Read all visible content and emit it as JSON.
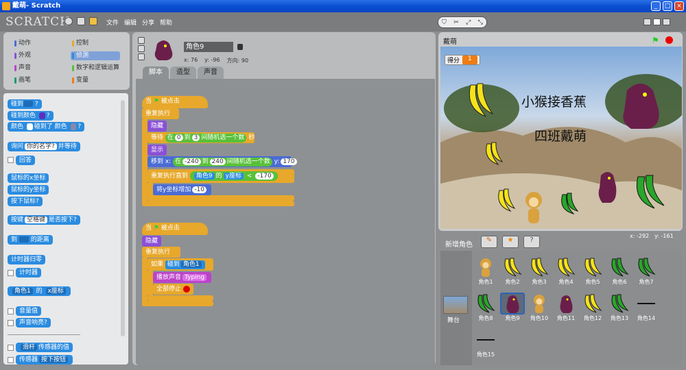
{
  "window": {
    "title": "戴萌- Scratch",
    "min": "_",
    "max": "□",
    "close": "×"
  },
  "app": {
    "logo": "SCRATCH",
    "menus": [
      "文件",
      "编辑",
      "分享",
      "帮助"
    ]
  },
  "categories": [
    {
      "label": "动作",
      "color": "#4a6cd4"
    },
    {
      "label": "控制",
      "color": "#e7a82b"
    },
    {
      "label": "外观",
      "color": "#8b50d6"
    },
    {
      "label": "侦测",
      "color": "#2b8ce0"
    },
    {
      "label": "声音",
      "color": "#bb43c9"
    },
    {
      "label": "数字和逻辑运算",
      "color": "#59c03a"
    },
    {
      "label": "画笔",
      "color": "#0e9a6c"
    },
    {
      "label": "变量",
      "color": "#ee7d16"
    }
  ],
  "palette": {
    "touching": "碰到",
    "touching_color": "碰到颜色",
    "color": "颜色",
    "touch_color2": "碰到了 颜色",
    "q": "?",
    "ask": "询问",
    "ask_default": "你的名字?",
    "and_wait": "并等待",
    "answer": "回答",
    "mouse_x": "鼠标的x坐标",
    "mouse_y": "鼠标的y坐标",
    "mouse_down": "按下鼠标?",
    "key": "按键",
    "key_val": "空格键",
    "key_pressed": "是否按下?",
    "to": "到",
    "distance": "的距离",
    "timer_reset": "计时器归零",
    "timer": "计时器",
    "sprite1": "角色1",
    "of": "的",
    "xpos": "x座标",
    "loudness": "音量值",
    "loud": "声音响亮?",
    "slider": "滑杆",
    "sensor_val": "传感器的值",
    "sensor": "传感器",
    "btn_pressed": "按下按钮"
  },
  "sprite_info": {
    "name": "角色9",
    "x": "x: 76",
    "y": "y: -96",
    "dir": "方向: 90"
  },
  "tabs": [
    "脚本",
    "造型",
    "声音"
  ],
  "script1": {
    "when": "当",
    "clicked": "被点击",
    "forever": "重复执行",
    "hide": "隐藏",
    "wait": "等待",
    "in": "在",
    "to": "到",
    "rand": "间随机选一个数",
    "sec": "秒",
    "w1": "0",
    "w2": "3",
    "show": "显示",
    "goto": "移到 x:",
    "x1": "-240",
    "x2": "240",
    "y": "y:",
    "yv": "170",
    "repeat_until": "重复执行直到",
    "spr": "角色9",
    "of": "的",
    "ypos": "y座标",
    "lt": "<",
    "lv": "-170",
    "change": "将y坐标增加",
    "cv": "-10"
  },
  "script2": {
    "when": "当",
    "clicked": "被点击",
    "hide": "隐藏",
    "forever": "重复执行",
    "if": "如果",
    "touch": "碰到",
    "spr": "角色1",
    "play": "播放声音",
    "sound": "Typing",
    "stop": "全部停止"
  },
  "stage": {
    "title": "戴萌",
    "score_label": "得分",
    "score": "1",
    "text1": "小猴接香蕉",
    "text2": "四班戴萌",
    "mx": "x: -292",
    "my": "y: -161"
  },
  "sprites_header": "新增角色",
  "stage_label": "舞台",
  "sprites": [
    "角色1",
    "角色2",
    "角色3",
    "角色4",
    "角色5",
    "角色6",
    "角色7",
    "角色8",
    "角色9",
    "角色10",
    "角色11",
    "角色12",
    "角色13",
    "角色14",
    "角色15"
  ],
  "sprite_kinds": [
    "monkey",
    "yb",
    "yb",
    "yb",
    "yb",
    "gb",
    "gb",
    "gb",
    "ghost",
    "monkey",
    "ghost",
    "yb",
    "gb",
    "txt",
    "txt"
  ],
  "selected_sprite": "角色9"
}
